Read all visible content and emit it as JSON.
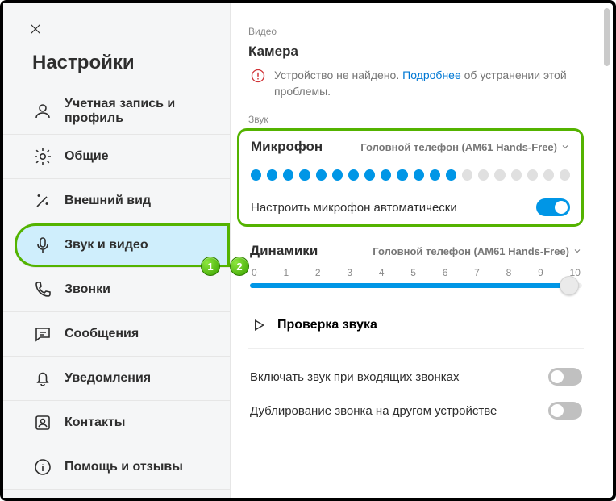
{
  "sidebar": {
    "title": "Настройки",
    "items": [
      {
        "label": "Учетная запись и профиль"
      },
      {
        "label": "Общие"
      },
      {
        "label": "Внешний вид"
      },
      {
        "label": "Звук и видео"
      },
      {
        "label": "Звонки"
      },
      {
        "label": "Сообщения"
      },
      {
        "label": "Уведомления"
      },
      {
        "label": "Контакты"
      },
      {
        "label": "Помощь и отзывы"
      }
    ]
  },
  "video": {
    "section_label": "Видео",
    "heading": "Камера",
    "warning_pre": "Устройство не найдено. ",
    "learn_more": "Подробнее",
    "warning_post": " об устранении этой проблемы."
  },
  "sound": {
    "section_label": "Звук",
    "mic": {
      "heading": "Микрофон",
      "device": "Головной телефон (AM61 Hands-Free)",
      "filled_dots": 13,
      "total_dots": 20,
      "auto_label": "Настроить микрофон автоматически"
    },
    "speakers": {
      "heading": "Динамики",
      "device": "Головной телефон (AM61 Hands-Free)",
      "scale": [
        "0",
        "1",
        "2",
        "3",
        "4",
        "5",
        "6",
        "7",
        "8",
        "9",
        "10"
      ]
    },
    "test_label": "Проверка звука",
    "setting_incoming": "Включать звук при входящих звонках",
    "setting_duplicate": "Дублирование звонка на другом устройстве"
  },
  "badges": {
    "one": "1",
    "two": "2"
  }
}
